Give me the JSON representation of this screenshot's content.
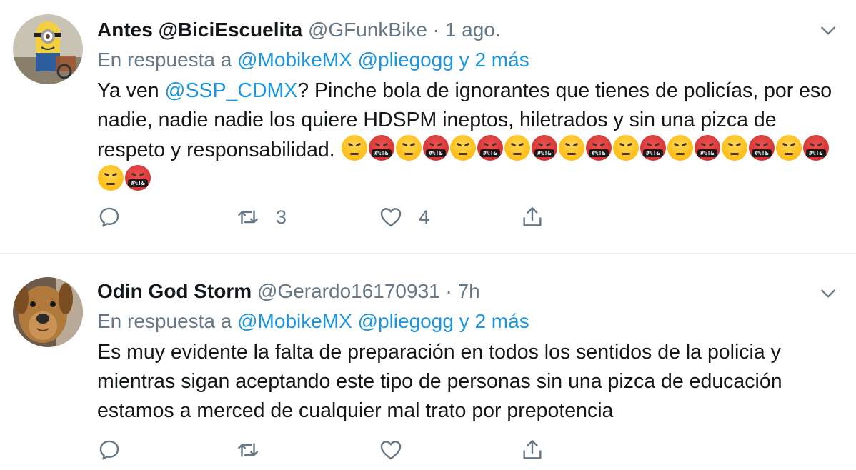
{
  "tweets": [
    {
      "name": "Antes @BiciEscuelita",
      "handle": "@GFunkBike",
      "separator": "·",
      "time": "1 ago.",
      "reply_prefix": "En respuesta a",
      "reply_mentions": "@MobikeMX @pliegogg y 2 más",
      "text_before": "Ya ven ",
      "text_mention": "@SSP_CDMX",
      "text_after": "? Pinche bola de ignorantes que tienes de policías, por eso nadie, nadie nadie los quiere HDSPM ineptos, hiletrados y sin una pizca de respeto y responsabilidad. ",
      "emojis": [
        "angry-face",
        "cursing-face",
        "angry-face",
        "cursing-face",
        "angry-face",
        "cursing-face",
        "angry-face",
        "cursing-face",
        "angry-face",
        "cursing-face",
        "angry-face",
        "cursing-face",
        "angry-face",
        "cursing-face",
        "angry-face",
        "cursing-face",
        "angry-face",
        "cursing-face",
        "angry-face",
        "cursing-face"
      ],
      "cursing_symbols": "#%!&",
      "replies": "",
      "retweets": "3",
      "likes": "4",
      "avatar_icon": "minion-avatar"
    },
    {
      "name": "Odin God Storm",
      "handle": "@Gerardo16170931",
      "separator": "·",
      "time": "7h",
      "reply_prefix": "En respuesta a",
      "reply_mentions": "@MobikeMX @pliegogg y 2 más",
      "text": "Es muy evidente la falta de preparación en todos los sentidos de la policia y mientras sigan aceptando este tipo de personas sin una pizca de educación estamos a merced de cualquier mal trato por prepotencia",
      "replies": "",
      "retweets": "",
      "likes": "",
      "avatar_icon": "dog-avatar"
    }
  ],
  "icons": {
    "reply": "reply-icon",
    "retweet": "retweet-icon",
    "like": "heart-icon",
    "share": "share-icon",
    "menu": "chevron-down-icon"
  },
  "colors": {
    "link": "#1b95e0",
    "secondary_text": "#657786",
    "primary_text": "#14171a",
    "divider": "#e6ecf0"
  }
}
